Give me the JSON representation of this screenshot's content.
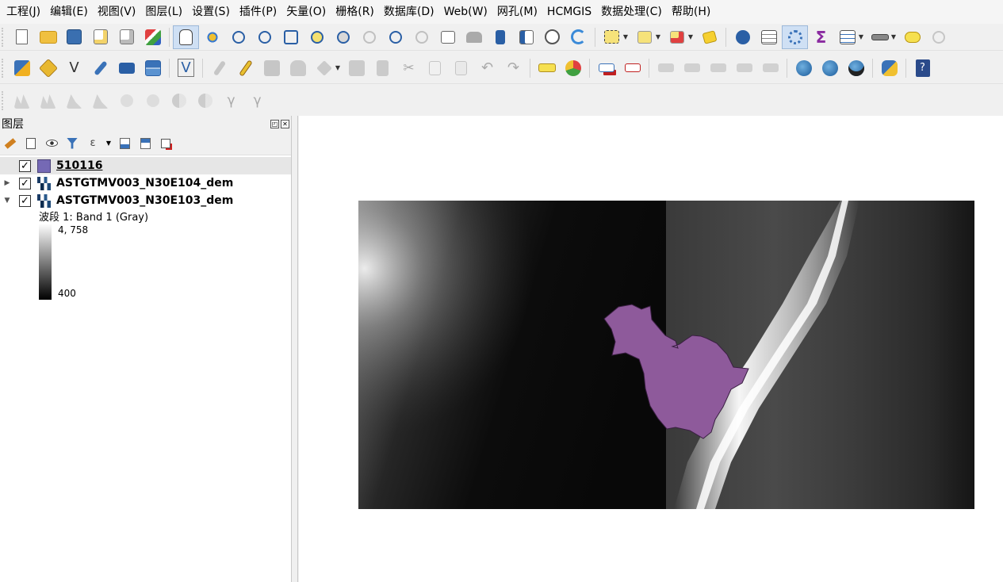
{
  "menubar": {
    "items": [
      "工程(J)",
      "编辑(E)",
      "视图(V)",
      "图层(L)",
      "设置(S)",
      "插件(P)",
      "矢量(O)",
      "栅格(R)",
      "数据库(D)",
      "Web(W)",
      "网孔(M)",
      "HCMGIS",
      "数据处理(C)",
      "帮助(H)"
    ]
  },
  "layers_panel": {
    "title": "图层",
    "float_button": "◰",
    "close_button": "✕",
    "layers": [
      {
        "name": "510116",
        "type": "vector",
        "checked": true,
        "expanded": false,
        "color": "#7569b5"
      },
      {
        "name": "ASTGTMV003_N30E104_dem",
        "type": "raster",
        "checked": true,
        "expanded": false
      },
      {
        "name": "ASTGTMV003_N30E103_dem",
        "type": "raster",
        "checked": true,
        "expanded": true
      }
    ],
    "legend": {
      "band_label": "波段 1: Band 1 (Gray)",
      "max_value": "4, 758",
      "min_value": "400"
    }
  },
  "map": {
    "polygon_color": "#8e5a9b",
    "background": "#ffffff"
  }
}
